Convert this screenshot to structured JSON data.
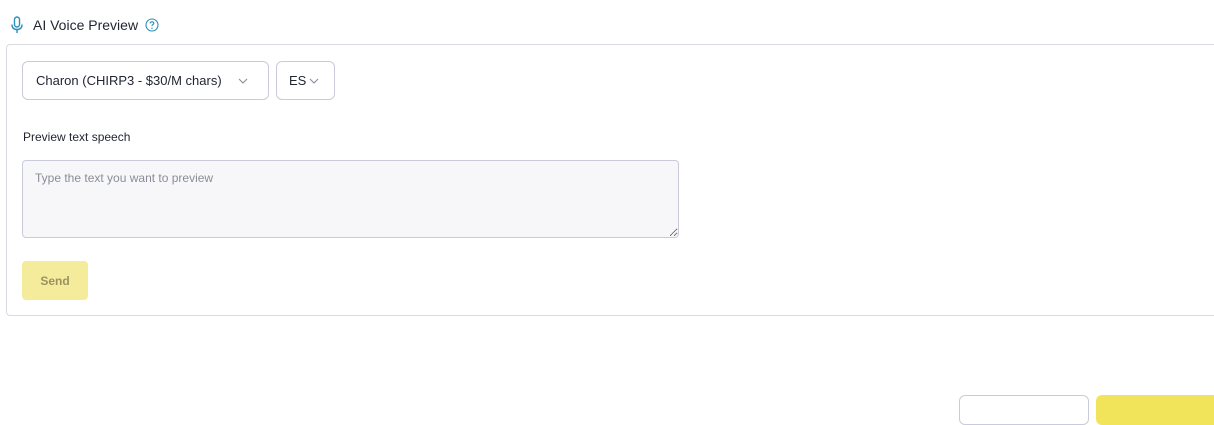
{
  "header": {
    "title": "AI Voice Preview",
    "icon": "microphone-icon",
    "help_icon": "help-circle-icon",
    "accent_color": "#2b8fb8"
  },
  "voice_select": {
    "value": "Charon (CHIRP3 - $30/M chars)"
  },
  "language_select": {
    "value": "ES"
  },
  "preview": {
    "label": "Preview text speech",
    "placeholder": "Type the text you want to preview",
    "value": ""
  },
  "send_button": {
    "label": "Send",
    "color": "#f4ec9b"
  },
  "footer": {
    "primary_color": "#f2e45a"
  }
}
